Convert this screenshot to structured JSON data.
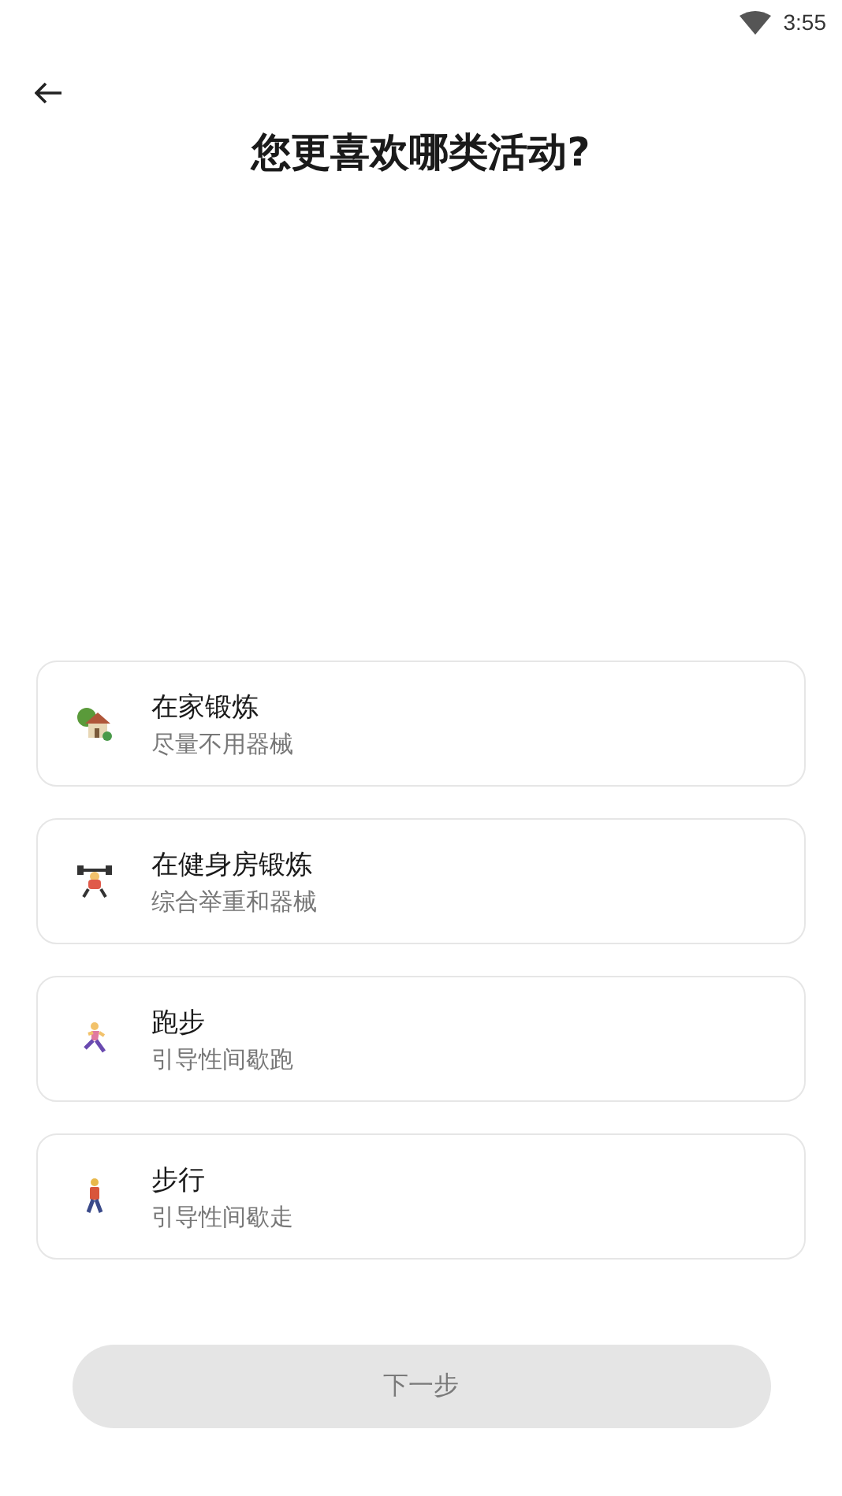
{
  "status_bar": {
    "time": "3:55"
  },
  "title": "您更喜欢哪类活动?",
  "options": [
    {
      "kind": "home",
      "label": "在家锻炼",
      "subtitle": "尽量不用器械",
      "selected": false
    },
    {
      "kind": "gym",
      "label": "在健身房锻炼",
      "subtitle": "综合举重和器械",
      "selected": false
    },
    {
      "kind": "run",
      "label": "跑步",
      "subtitle": "引导性间歇跑",
      "selected": false
    },
    {
      "kind": "walk",
      "label": "步行",
      "subtitle": "引导性间歇走",
      "selected": false
    }
  ],
  "next_button": {
    "label": "下一步",
    "disabled": true
  }
}
